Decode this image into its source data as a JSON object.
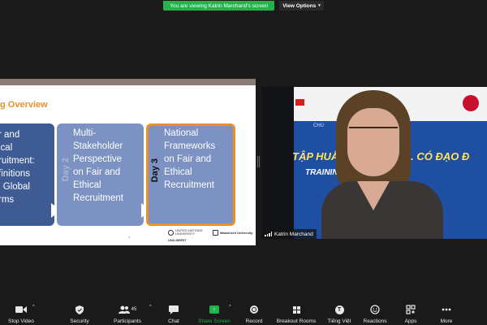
{
  "top_bar": {
    "viewing_text": "You are viewing Katrin Marchand's screen",
    "view_options_label": "View Options",
    "colors": {
      "viewing_bg": "#23b24b"
    }
  },
  "slide": {
    "title": "g Overview",
    "cards": [
      {
        "lines": [
          "r and",
          "ical",
          "ruitment:",
          "finitions",
          "l Global",
          "rms"
        ]
      },
      {
        "day": "Day 2",
        "lines": [
          "Multi-",
          "Stakeholder",
          "Perspective",
          "on Fair and",
          "Ethical",
          "Recruitment"
        ]
      },
      {
        "day": "Day 3",
        "lines": [
          "National",
          "Frameworks",
          "on Fair and",
          "Ethical",
          "Recruitment"
        ]
      }
    ],
    "page_number": "1",
    "logos": {
      "un_university": "UNITED NATIONS UNIVERSITY",
      "un_sub": "UNU-MERIT",
      "maastricht": "Maastricht University"
    },
    "colors": {
      "title": "#e7912a",
      "card_dark": "#3f5b94",
      "card": "#7c92c2",
      "highlight_border": "#e7912a"
    }
  },
  "video": {
    "participant_name": "Katrin Marchand",
    "banner_text_1": "TẬP HUẤN VỀ TUYỂN ... CÓ ĐẠO Đ",
    "banner_text_2": "TRAINING ON",
    "banner_small": "CHU"
  },
  "toolbar": {
    "items": [
      {
        "label": "Stop Video",
        "icon": "video-camera-icon"
      },
      {
        "label": "Security",
        "icon": "shield-icon"
      },
      {
        "label": "Participants",
        "icon": "participants-icon",
        "count": "45"
      },
      {
        "label": "Chat",
        "icon": "chat-bubble-icon"
      },
      {
        "label": "Share Screen",
        "icon": "share-screen-icon"
      },
      {
        "label": "Record",
        "icon": "record-icon"
      },
      {
        "label": "Breakout Rooms",
        "icon": "breakout-rooms-icon"
      },
      {
        "label": "Tiếng Việt",
        "icon": "language-icon",
        "icon_letter": "T"
      },
      {
        "label": "Reactions",
        "icon": "reactions-icon"
      },
      {
        "label": "Apps",
        "icon": "apps-icon"
      },
      {
        "label": "More",
        "icon": "more-icon"
      }
    ]
  }
}
